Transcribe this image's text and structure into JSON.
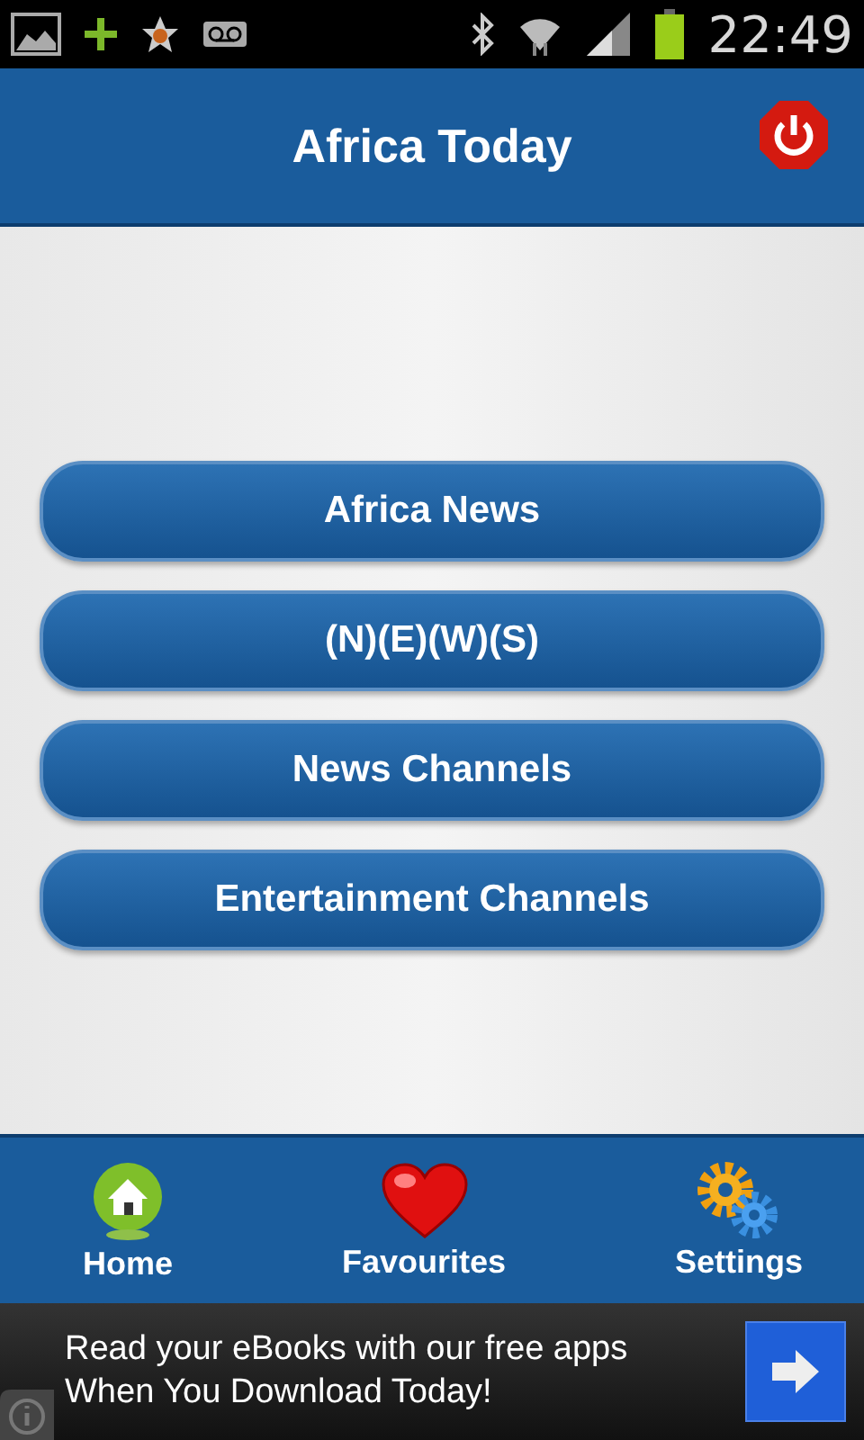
{
  "status_bar": {
    "time": "22:49"
  },
  "header": {
    "title": "Africa Today"
  },
  "menu": [
    {
      "label": "Africa News"
    },
    {
      "label": "(N)(E)(W)(S)"
    },
    {
      "label": "News Channels"
    },
    {
      "label": "Entertainment Channels"
    }
  ],
  "bottom_nav": [
    {
      "kind": "home",
      "label": "Home"
    },
    {
      "kind": "favourites",
      "label": "Favourites"
    },
    {
      "kind": "settings",
      "label": "Settings"
    }
  ],
  "ad": {
    "lines": [
      "Read your eBooks with our free apps",
      "When You Download Today!"
    ]
  }
}
